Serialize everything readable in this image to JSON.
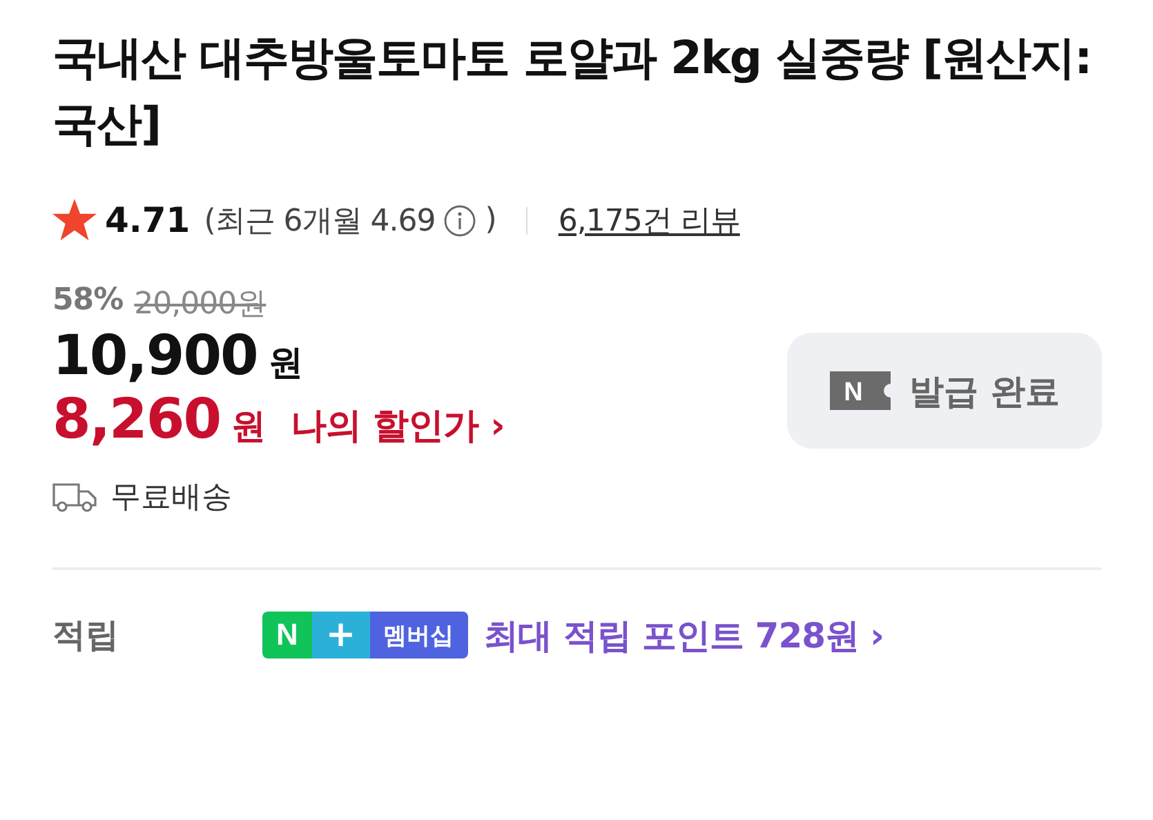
{
  "title": "국내산 대추방울토마토 로얄과 2kg 실중량 [원산지:국산]",
  "rating": {
    "score": "4.71",
    "recent": "(최근 6개월 4.69",
    "recent_close": ")",
    "reviews": "6,175건 리뷰"
  },
  "price": {
    "discount": "58%",
    "original": "20,000원",
    "sale": "10,900",
    "sale_unit": "원",
    "my_price": "8,260",
    "my_unit": "원",
    "my_label": "나의 할인가",
    "my_arrow": "›"
  },
  "coupon": {
    "mark": "N",
    "label": "발급 완료"
  },
  "shipping": "무료배송",
  "points": {
    "label": "적립",
    "badge": [
      "N",
      "+",
      "멤버십"
    ],
    "text": "최대 적립 포인트 728원",
    "arrow": "›"
  }
}
